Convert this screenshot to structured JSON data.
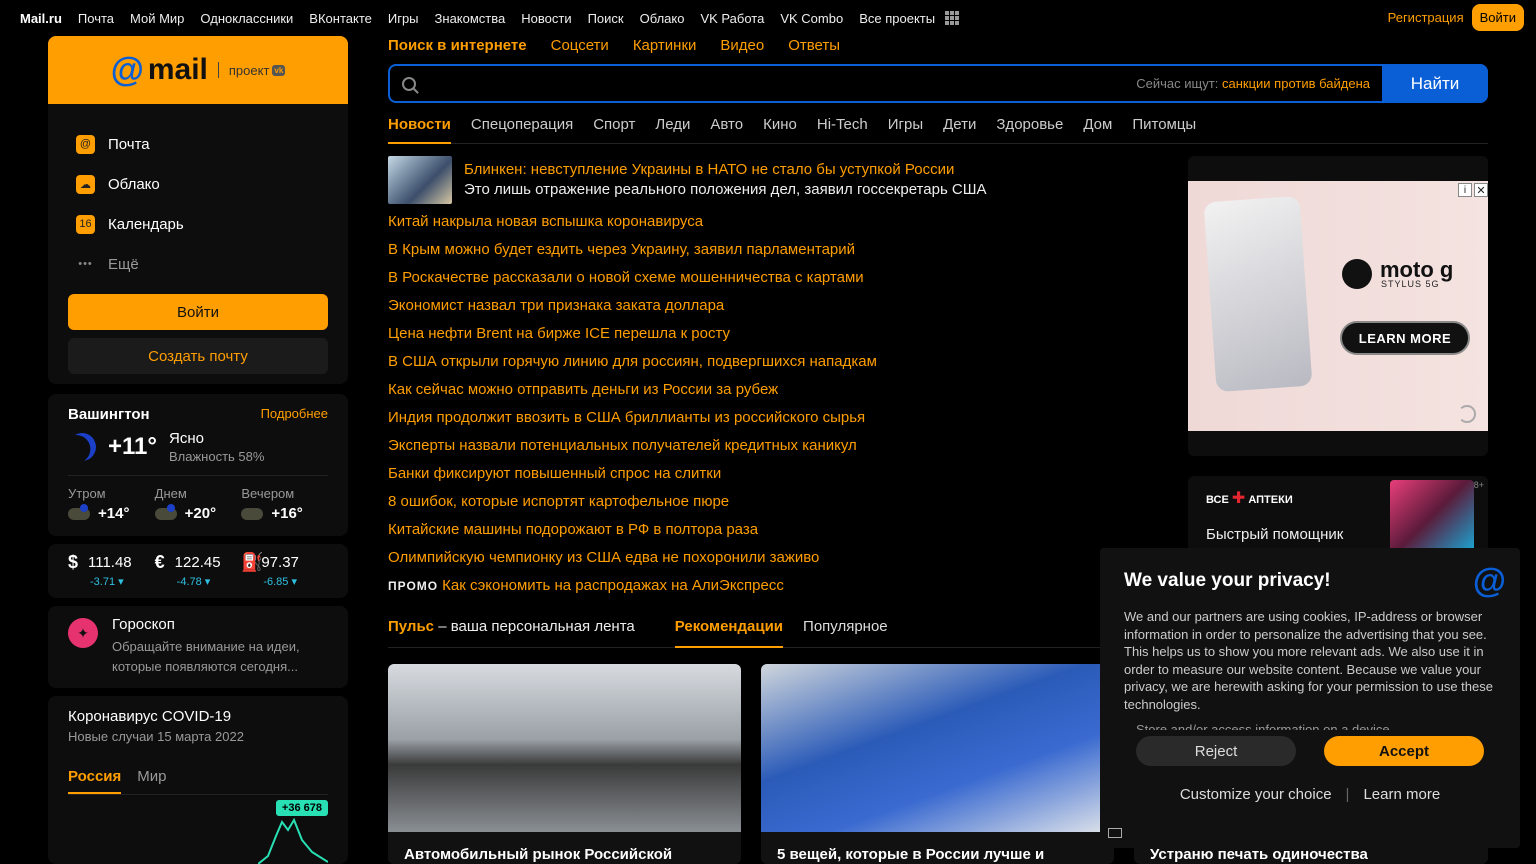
{
  "topbar": {
    "brand": "Mail.ru",
    "items": [
      "Почта",
      "Мой Мир",
      "Одноклассники",
      "ВКонтакте",
      "Игры",
      "Знакомства",
      "Новости",
      "Поиск",
      "Облако",
      "VK Работа",
      "VK Combo",
      "Все проекты"
    ],
    "register": "Регистрация",
    "login": "Войти"
  },
  "mail_card": {
    "logo_at": "@",
    "logo_text": "mail",
    "project_label": "проект",
    "vk_badge": "vk",
    "items": [
      {
        "label": "Почта",
        "icon": "@"
      },
      {
        "label": "Облако",
        "icon": "☁"
      },
      {
        "label": "Календарь",
        "icon": "16"
      }
    ],
    "more_label": "Ещё",
    "more_icon": "•••",
    "login_button": "Войти",
    "create_button": "Создать почту"
  },
  "weather": {
    "city": "Вашингтон",
    "more": "Подробнее",
    "temp": "+11°",
    "desc": "Ясно",
    "humidity": "Влажность 58%",
    "parts": [
      {
        "label": "Утром",
        "temp": "+14°"
      },
      {
        "label": "Днем",
        "temp": "+20°"
      },
      {
        "label": "Вечером",
        "temp": "+16°"
      }
    ]
  },
  "currency": [
    {
      "symbol": "$",
      "value": "111.48",
      "change": "-3.71 ▾"
    },
    {
      "symbol": "€",
      "value": "122.45",
      "change": "-4.78 ▾"
    },
    {
      "symbol": "⛽",
      "value": "97.37",
      "change": "-6.85 ▾"
    }
  ],
  "horoscope": {
    "title": "Гороскоп",
    "text": "Обращайте внимание на идеи, которые появляются сегодня..."
  },
  "covid": {
    "title": "Коронавирус COVID-19",
    "subtitle": "Новые случаи 15 марта 2022",
    "tabs": [
      "Россия",
      "Мир"
    ],
    "badge": "+36 678"
  },
  "search": {
    "tabs": [
      "Поиск в интернете",
      "Соцсети",
      "Картинки",
      "Видео",
      "Ответы"
    ],
    "hint_label": "Сейчас ищут:",
    "hint_query": "санкции против байдена",
    "button": "Найти",
    "value": ""
  },
  "news_tabs": [
    "Новости",
    "Спецоперация",
    "Спорт",
    "Леди",
    "Авто",
    "Кино",
    "Hi-Tech",
    "Игры",
    "Дети",
    "Здоровье",
    "Дом",
    "Питомцы"
  ],
  "headline": {
    "title": "Блинкен: невступление Украины в НАТО не стало бы уступкой России",
    "subtitle": "Это лишь отражение реального положения дел, заявил госсекретарь США"
  },
  "news": [
    "Китай накрыла новая вспышка коронавируса",
    "В Крым можно будет ездить через Украину, заявил парламентарий",
    "В Роскачестве рассказали о новой схеме мошенничества с картами",
    "Экономист назвал три признака заката доллара",
    "Цена нефти Brent на бирже ICE перешла к росту",
    "В США открыли горячую линию для россиян, подвергшихся нападкам",
    "Как сейчас можно отправить деньги из России за рубеж",
    "Индия продолжит ввозить в США бриллианты из российского сырья",
    "Эксперты назвали потенциальных получателей кредитных каникул",
    "Банки фиксируют повышенный спрос на слитки",
    "8 ошибок, которые испортят картофельное пюре",
    "Китайские машины подорожают в РФ в полтора раза",
    "Олимпийскую чемпионку из США едва не похоронили заживо"
  ],
  "promo": {
    "tag": "ПРОМО",
    "text": "Как сэкономить на распродажах на АлиЭкспресс"
  },
  "feed": {
    "title_bold": "Пульс",
    "title_rest": " – ваша персональная лента",
    "tabs": [
      "Рекомендации",
      "Популярное"
    ],
    "cards": [
      "Автомобильный рынок Российской",
      "5 вещей, которые в России лучше и",
      "Устраню печать одиночества"
    ]
  },
  "ad1": {
    "brand": "moto g",
    "model": "STYLUS 5G",
    "cta": "LEARN MORE",
    "info": "i",
    "close": "✕"
  },
  "ad2": {
    "brand_a": "ВСЕ",
    "brand_plus": "✚",
    "brand_b": "АПТЕКИ",
    "age": "18+",
    "text": "Быстрый помощник"
  },
  "privacy": {
    "title": "We value your privacy!",
    "logo": "@",
    "text": "We and our partners are using cookies, IP-address or browser information in order to personalize the advertising that you see. This helps us to show you more relevant ads. We also use it in order to measure our website content. Because we value your privacy, we are herewith asking for your permission to use these technologies.",
    "cut_line": "Store and/or access information on a device",
    "reject": "Reject",
    "accept": "Accept",
    "customize": "Customize your choice",
    "separator": "|",
    "learn_more": "Learn more"
  }
}
